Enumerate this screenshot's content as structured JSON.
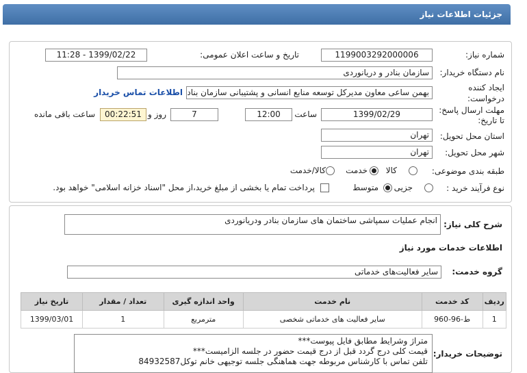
{
  "title": "جزئیات اطلاعات نیاز",
  "form": {
    "need_number_label": "شماره نیاز:",
    "need_number": "1199003292000006",
    "announce_label": "تاریخ و ساعت اعلان عمومی:",
    "announce_value": "1399/02/22 - 11:28",
    "buyer_label": "نام دستگاه خریدار:",
    "buyer_value": "سازمان بنادر و دریانوردی",
    "creator_label_1": "ایجاد کننده",
    "creator_label_2": "درخواست:",
    "creator_value": "بهمن ساعی معاون مدیرکل توسعه منابع انسانی و پشتیبانی سازمان بنادر و در",
    "contact_link": "اطلاعات تماس خریدار",
    "deadline_label_1": "مهلت ارسال پاسخ:",
    "deadline_label_2": "تا تاریخ:",
    "deadline_date": "1399/02/29",
    "time_label": "ساعت",
    "deadline_time": "12:00",
    "days_value": "7",
    "days_label": "روز و",
    "remaining_time": "00:22:51",
    "remaining_label": "ساعت باقی مانده",
    "province_label": "استان محل تحویل:",
    "province_value": "تهران",
    "city_label": "شهر محل تحویل:",
    "city_value": "تهران",
    "category_label": "طبقه بندی موضوعی:",
    "category_options": [
      "کالا",
      "خدمت",
      "کالا/خدمت"
    ],
    "category_selected": "خدمت",
    "process_label": "نوع فرآیند خرید :",
    "process_options": [
      "جزیی",
      "متوسط"
    ],
    "process_selected": "متوسط",
    "payment_note": "پرداخت تمام یا بخشی از مبلغ خرید،از محل \"اسناد خزانه اسلامی\" خواهد بود."
  },
  "details": {
    "summary_label": "شرح کلی نیاز:",
    "summary_value": "انجام عملیات سمپاشی ساختمان های سازمان بنادر ودریانوردی",
    "services_heading": "اطلاعات خدمات مورد نیاز",
    "group_label": "گروه خدمت:",
    "group_value": "سایر فعالیت‌های خدماتی"
  },
  "table": {
    "headers": [
      "ردیف",
      "کد خدمت",
      "نام خدمت",
      "واحد اندازه گیری",
      "تعداد / مقدار",
      "تاریخ نیاز"
    ],
    "rows": [
      [
        "1",
        "ط-96-960",
        "سایر فعالیت های خدماتی شخصی",
        "مترمربع",
        "1",
        "1399/03/01"
      ]
    ]
  },
  "notes": {
    "label": "توضیحات خریدار:",
    "lines": [
      "متراژ وشرایط مطابق فایل پیوست***",
      "قیمت کلی درج گردد قبل از درج قیمت حضور در جلسه الزامیست***",
      "تلفن تماس با کارشناس مربوطه جهت هماهنگی جلسه توجیهی خانم توکل84932587"
    ]
  }
}
